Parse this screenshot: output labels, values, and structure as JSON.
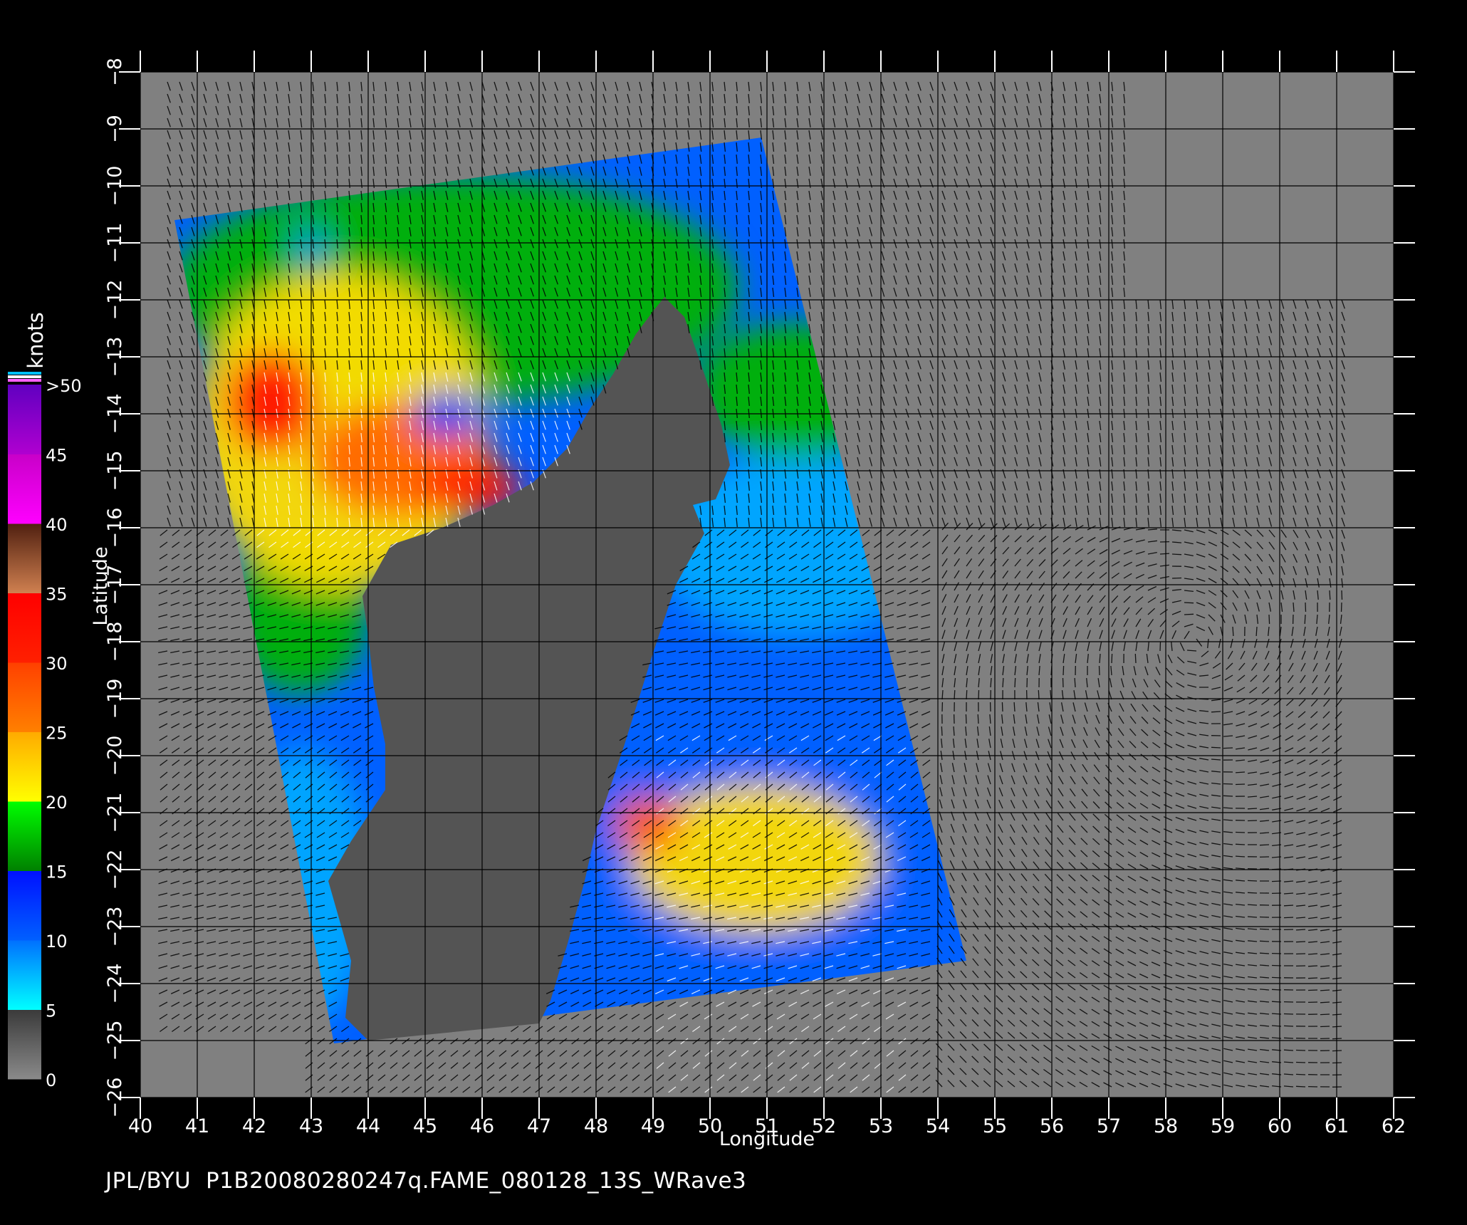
{
  "colors": {
    "background": "#000000",
    "missing": "#808080",
    "land": "#545454",
    "grid": "#000000",
    "vector": "#000000",
    "vector_high": "#ffffff",
    "text": "#ffffff"
  },
  "axes": {
    "xlabel": "Longitude",
    "ylabel": "Latitude",
    "x_ticks": [
      "40",
      "41",
      "42",
      "43",
      "44",
      "45",
      "46",
      "47",
      "48",
      "49",
      "50",
      "51",
      "52",
      "53",
      "54",
      "55",
      "56",
      "57",
      "58",
      "59",
      "60",
      "61",
      "62"
    ],
    "y_ticks": [
      "−8",
      "−9",
      "−10",
      "−11",
      "−12",
      "−13",
      "−14",
      "−15",
      "−16",
      "−17",
      "−18",
      "−19",
      "−20",
      "−21",
      "−22",
      "−23",
      "−24",
      "−25",
      "−26"
    ],
    "xlim": [
      40,
      62
    ],
    "ylim": [
      -26,
      -8
    ]
  },
  "colorbar": {
    "title": "knots",
    "labels": [
      ">50",
      "45",
      "40",
      "35",
      "30",
      "25",
      "20",
      "15",
      "10",
      "5",
      "0"
    ],
    "bands": [
      {
        "from": 0,
        "to": 5,
        "top": "#3a3a3a",
        "bottom": "#8a8a8a"
      },
      {
        "from": 5,
        "to": 10,
        "top": "#0070ff",
        "bottom": "#00ffff"
      },
      {
        "from": 10,
        "to": 15,
        "top": "#0010ff",
        "bottom": "#0060ff"
      },
      {
        "from": 15,
        "to": 20,
        "top": "#00ff00",
        "bottom": "#008000"
      },
      {
        "from": 20,
        "to": 25,
        "top": "#ffaa00",
        "bottom": "#ffff00"
      },
      {
        "from": 25,
        "to": 30,
        "top": "#ff4000",
        "bottom": "#ff8000"
      },
      {
        "from": 30,
        "to": 35,
        "top": "#ff0000",
        "bottom": "#ff2000"
      },
      {
        "from": 35,
        "to": 40,
        "top": "#502010",
        "bottom": "#d08050"
      },
      {
        "from": 40,
        "to": 45,
        "top": "#c800c8",
        "bottom": "#ff00ff"
      },
      {
        "from": 45,
        "to": 50,
        "top": "#6000c0",
        "bottom": "#b000d0"
      }
    ],
    "cap_colors": [
      "#00c0ff",
      "#ffffff",
      "#ff60ff"
    ]
  },
  "swath": {
    "corners": [
      [
        40.6,
        -10.6
      ],
      [
        50.9,
        -9.15
      ],
      [
        54.5,
        -23.6
      ],
      [
        43.4,
        -25.05
      ]
    ]
  },
  "land_polygon": [
    [
      49.2,
      -11.95
    ],
    [
      49.55,
      -12.3
    ],
    [
      49.9,
      -13.3
    ],
    [
      50.2,
      -14.2
    ],
    [
      50.35,
      -14.9
    ],
    [
      50.1,
      -15.5
    ],
    [
      49.7,
      -15.6
    ],
    [
      49.9,
      -16.1
    ],
    [
      49.4,
      -17.0
    ],
    [
      49.0,
      -18.2
    ],
    [
      48.5,
      -19.8
    ],
    [
      48.0,
      -21.3
    ],
    [
      47.8,
      -22.2
    ],
    [
      47.5,
      -23.3
    ],
    [
      47.2,
      -24.3
    ],
    [
      47.0,
      -24.7
    ],
    [
      44.0,
      -25.0
    ],
    [
      43.6,
      -24.6
    ],
    [
      43.7,
      -23.6
    ],
    [
      43.3,
      -22.2
    ],
    [
      43.7,
      -21.5
    ],
    [
      44.3,
      -20.6
    ],
    [
      44.3,
      -19.8
    ],
    [
      44.1,
      -18.8
    ],
    [
      44.0,
      -17.9
    ],
    [
      43.9,
      -17.2
    ],
    [
      44.4,
      -16.3
    ],
    [
      45.3,
      -16.0
    ],
    [
      46.2,
      -15.6
    ],
    [
      46.9,
      -15.2
    ],
    [
      47.5,
      -14.6
    ],
    [
      47.9,
      -13.9
    ],
    [
      48.3,
      -13.3
    ],
    [
      48.7,
      -12.6
    ],
    [
      49.0,
      -12.2
    ]
  ],
  "wind_zones": [
    {
      "speed": 10,
      "center": [
        47.5,
        -22.5
      ],
      "radius": [
        6.0,
        4.0
      ]
    },
    {
      "speed": 8,
      "center": [
        51.5,
        -16.3
      ],
      "radius": [
        2.5,
        1.6
      ]
    },
    {
      "speed": 8,
      "center": [
        42.8,
        -22.3
      ],
      "radius": [
        1.2,
        2.4
      ]
    },
    {
      "speed": 17,
      "center": [
        45.5,
        -11.8
      ],
      "radius": [
        5.0,
        2.0
      ]
    },
    {
      "speed": 17,
      "center": [
        51.5,
        -13.6
      ],
      "radius": [
        1.8,
        1.2
      ]
    },
    {
      "speed": 17,
      "center": [
        42.8,
        -17.5
      ],
      "radius": [
        1.2,
        1.4
      ]
    },
    {
      "speed": 22,
      "center": [
        43.5,
        -14.3
      ],
      "radius": [
        2.6,
        2.8
      ]
    },
    {
      "speed": 22,
      "center": [
        50.8,
        -21.8
      ],
      "radius": [
        2.2,
        1.3
      ]
    },
    {
      "speed": 27,
      "center": [
        44.6,
        -14.8
      ],
      "radius": [
        1.6,
        1.0
      ]
    },
    {
      "speed": 32,
      "center": [
        42.3,
        -13.8
      ],
      "radius": [
        0.8,
        0.9
      ]
    },
    {
      "speed": 32,
      "center": [
        45.8,
        -15.3
      ],
      "radius": [
        0.9,
        0.45
      ]
    },
    {
      "speed": 28,
      "center": [
        48.9,
        -21.2
      ],
      "radius": [
        0.6,
        0.5
      ]
    },
    {
      "speed": 12,
      "center": [
        45.4,
        -14.0
      ],
      "radius": [
        0.6,
        0.4
      ]
    },
    {
      "speed": 9,
      "center": [
        43.0,
        -11.1
      ],
      "radius": [
        0.25,
        0.3
      ]
    }
  ],
  "footer": {
    "text": "JPL/BYU  P1B20080280247q.FAME_080128_13S_WRave3"
  }
}
